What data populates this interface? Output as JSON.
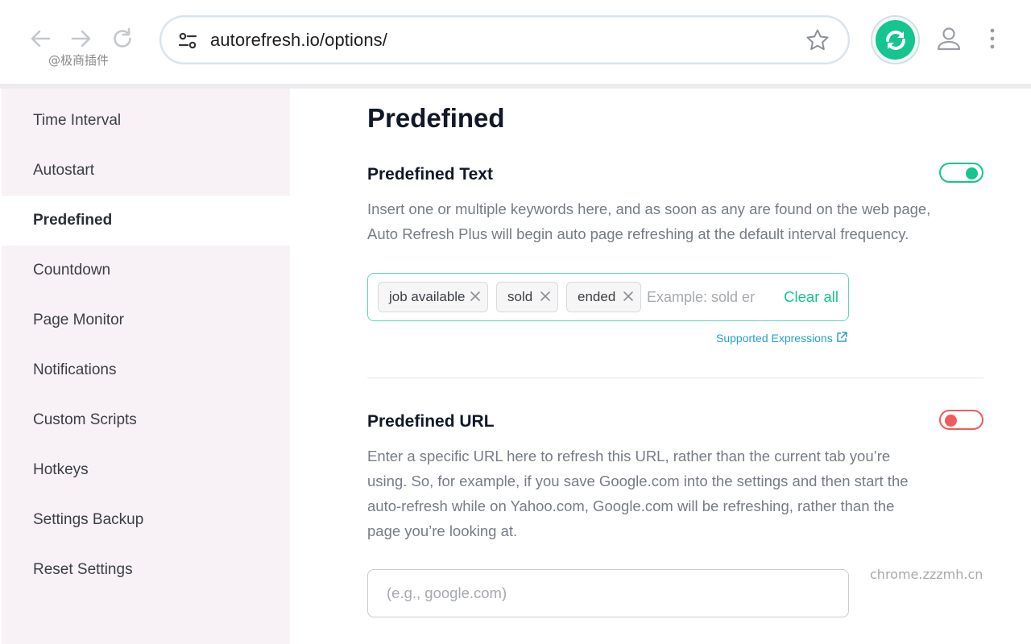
{
  "browser": {
    "url": "autorefresh.io/options/",
    "watermark": "@极商插件",
    "icons": {
      "back": "arrow-left-icon",
      "forward": "arrow-right-icon",
      "reload": "reload-icon",
      "site_info": "tune-icon",
      "bookmark": "star-icon",
      "extension": "auto-refresh-icon",
      "profile": "profile-icon",
      "menu": "kebab-menu-icon"
    },
    "accent": "#14c58e"
  },
  "sidebar": {
    "items": [
      {
        "label": "Time Interval",
        "active": false
      },
      {
        "label": "Autostart",
        "active": false
      },
      {
        "label": "Predefined",
        "active": true
      },
      {
        "label": "Countdown",
        "active": false
      },
      {
        "label": "Page Monitor",
        "active": false
      },
      {
        "label": "Notifications",
        "active": false
      },
      {
        "label": "Custom Scripts",
        "active": false
      },
      {
        "label": "Hotkeys",
        "active": false
      },
      {
        "label": "Settings Backup",
        "active": false
      },
      {
        "label": "Reset Settings",
        "active": false
      }
    ]
  },
  "main": {
    "title": "Predefined",
    "predefined_text": {
      "title": "Predefined Text",
      "enabled": true,
      "description": "Insert one or multiple keywords here, and as soon as any are found on the web page, Auto Refresh Plus will begin auto page refreshing at the default interval frequency.",
      "tags": [
        "job available",
        "sold",
        "ended"
      ],
      "input_placeholder": "Example: sold er",
      "clear_all": "Clear all",
      "supported_link": "Supported Expressions"
    },
    "predefined_url": {
      "title": "Predefined URL",
      "enabled": false,
      "description": "Enter a specific URL here to refresh this URL, rather than the current tab you’re using. So, for example, if you save Google.com into the settings and then start the auto-refresh while on Yahoo.com, Google.com will be refreshing, rather than the page you’re looking at.",
      "input_placeholder": "(e.g., google.com)"
    },
    "watermark": "chrome.zzzmh.cn",
    "colors": {
      "toggle_on": "#14c58e",
      "toggle_off": "#f15a5a",
      "link": "#2a9fd0"
    }
  }
}
